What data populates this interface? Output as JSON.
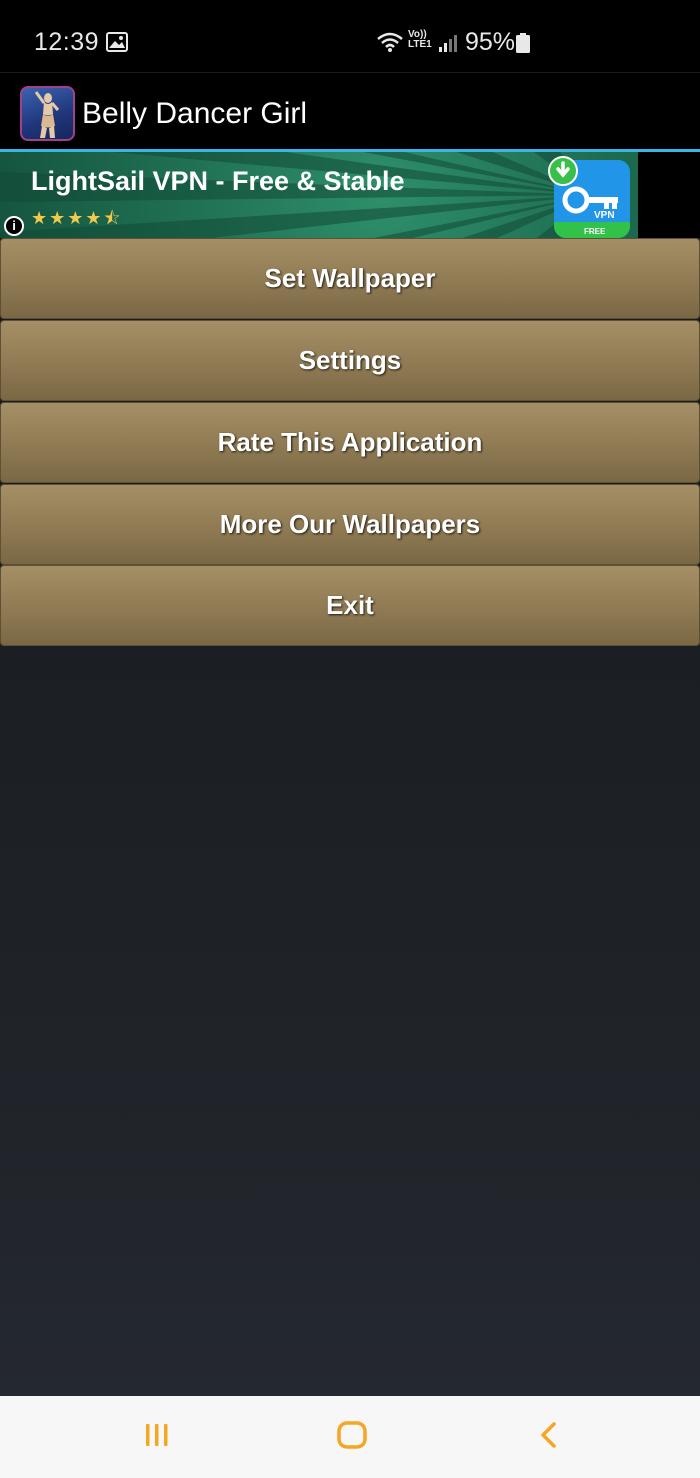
{
  "status_bar": {
    "time": "12:39",
    "battery_percent": "95%",
    "volte_top": "Vo))",
    "volte_bottom": "LTE1",
    "icons": [
      "gallery-icon",
      "wifi-icon",
      "volte-icon",
      "signal-icon",
      "battery-icon"
    ]
  },
  "app_bar": {
    "title": "Belly Dancer Girl",
    "accent_color": "#3bb4e6"
  },
  "ad": {
    "title": "LightSail VPN - Free & Stable",
    "rating_stars": "★★★★⯪",
    "rating": 4.5,
    "info_glyph": "i",
    "app_icon_label": "VPN",
    "app_icon_badge": "FREE"
  },
  "menu": {
    "items": [
      {
        "label": "Set Wallpaper"
      },
      {
        "label": "Settings"
      },
      {
        "label": "Rate This Application"
      },
      {
        "label": "More Our Wallpapers"
      },
      {
        "label": "Exit"
      }
    ],
    "button_color": "#9a855d"
  },
  "nav_bar": {
    "icons": [
      "recents-icon",
      "home-icon",
      "back-icon"
    ],
    "icon_color": "#f5a623"
  }
}
